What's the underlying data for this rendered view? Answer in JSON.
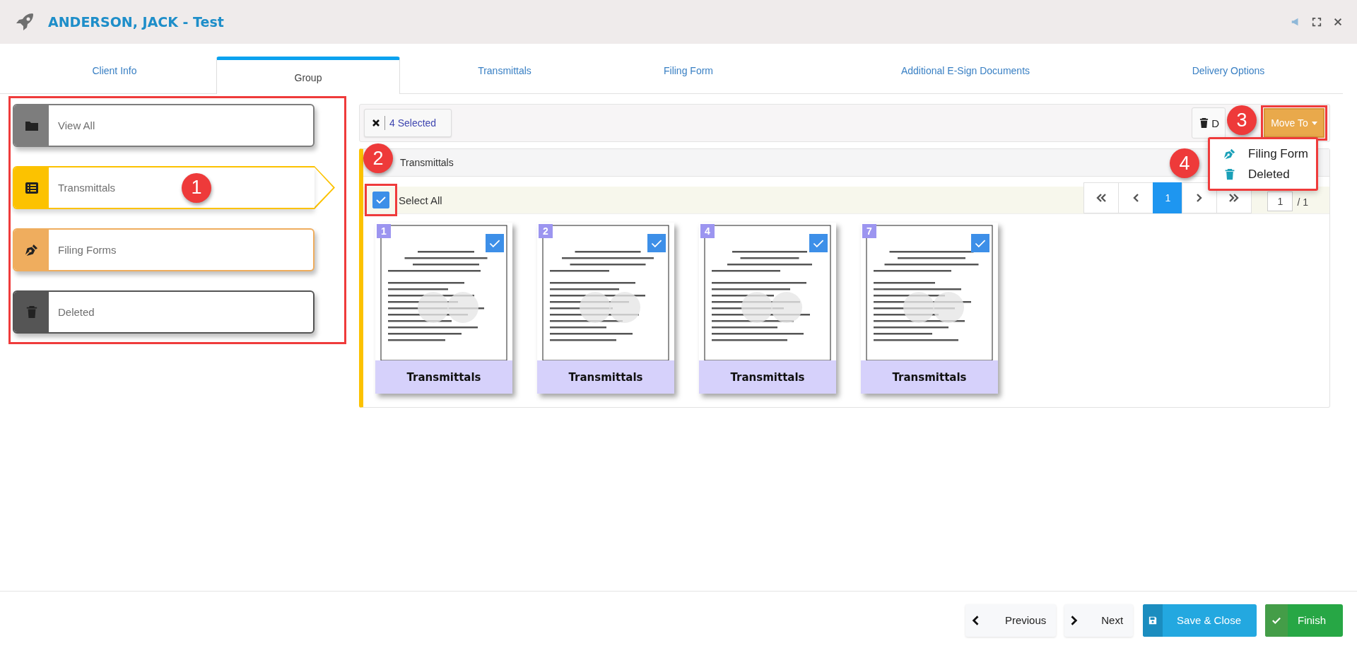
{
  "header": {
    "title": "ANDERSON, JACK - Test"
  },
  "tabs": [
    {
      "label": "Client Info",
      "selected": false
    },
    {
      "label": "Group",
      "selected": true
    },
    {
      "label": "Transmittals",
      "selected": false
    },
    {
      "label": "Filing Form",
      "selected": false
    },
    {
      "label": "Additional E-Sign Documents",
      "selected": false
    },
    {
      "label": "Delivery Options",
      "selected": false
    }
  ],
  "sidebar": {
    "annotation": "1",
    "items": [
      {
        "label": "View All",
        "kind": "folder",
        "color": "#7d7d7d",
        "selected": false
      },
      {
        "label": "Transmittals",
        "kind": "list",
        "color": "#fcc200",
        "selected": true
      },
      {
        "label": "Filing Forms",
        "kind": "pen",
        "color": "#efad5e",
        "selected": false
      },
      {
        "label": "Deleted",
        "kind": "trash",
        "color": "#555555",
        "selected": false
      }
    ]
  },
  "toolbar": {
    "selection_label": "4 Selected",
    "delete_label": "D",
    "move_to": {
      "label": "Move To",
      "expanded": true
    },
    "annotation": "3"
  },
  "menu": {
    "annotation": "4",
    "items": [
      {
        "label": "Filing Form",
        "kind": "pen"
      },
      {
        "label": "Deleted",
        "kind": "trash"
      }
    ]
  },
  "group": {
    "title": "Transmittals",
    "annotation": "2",
    "select_all": {
      "label": "Select All",
      "checked": true
    },
    "pagination": {
      "pages": [
        {
          "label": "1",
          "selected": true
        }
      ],
      "page_value": "1",
      "total": "/ 1"
    },
    "documents": [
      {
        "number": "1",
        "label": "Transmittals",
        "checked": true
      },
      {
        "number": "2",
        "label": "Transmittals",
        "checked": true
      },
      {
        "number": "4",
        "label": "Transmittals",
        "checked": true
      },
      {
        "number": "7",
        "label": "Transmittals",
        "checked": true
      }
    ]
  },
  "footer": {
    "buttons": [
      {
        "label": "Previous",
        "kind": "previous"
      },
      {
        "label": "Next",
        "kind": "next"
      },
      {
        "label": "Save & Close",
        "kind": "save"
      },
      {
        "label": "Finish",
        "kind": "finish"
      }
    ]
  }
}
